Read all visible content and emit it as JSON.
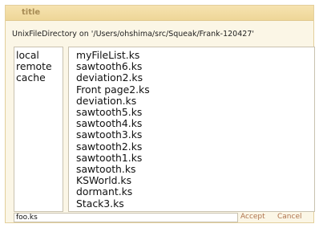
{
  "window": {
    "title": "title",
    "path_label": "UnixFileDirectory on '/Users/ohshima/src/Squeak/Frank-120427'"
  },
  "volumes": [
    "local",
    "remote",
    "cache"
  ],
  "files": [
    "myFileList.ks",
    "sawtooth6.ks",
    "deviation2.ks",
    "Front page2.ks",
    "deviation.ks",
    "sawtooth5.ks",
    "sawtooth4.ks",
    "sawtooth3.ks",
    "sawtooth2.ks",
    "sawtooth1.ks",
    "sawtooth.ks",
    "KSWorld.ks",
    "dormant.ks",
    "Stack3.ks"
  ],
  "filename_input": {
    "value": "foo.ks"
  },
  "buttons": {
    "accept": "Accept",
    "cancel": "Cancel"
  }
}
